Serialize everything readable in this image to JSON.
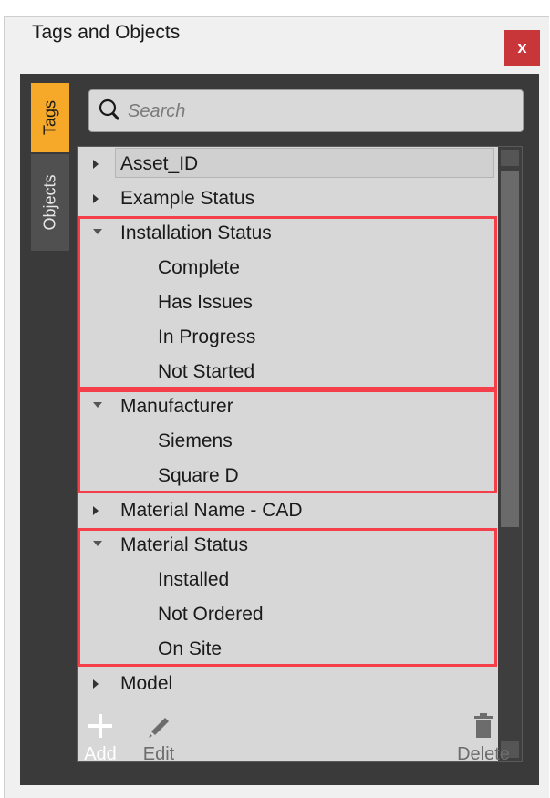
{
  "window": {
    "title": "Tags and Objects",
    "close_label": "x"
  },
  "tabs": [
    {
      "label": "Tags",
      "active": true
    },
    {
      "label": "Objects",
      "active": false
    }
  ],
  "search": {
    "placeholder": "Search",
    "value": ""
  },
  "tree": {
    "items": [
      {
        "label": "Asset_ID",
        "level": 0,
        "expanded": false,
        "selected": true
      },
      {
        "label": "Example Status",
        "level": 0,
        "expanded": false
      },
      {
        "label": "Installation Status",
        "level": 0,
        "expanded": true
      },
      {
        "label": "Complete",
        "level": 1
      },
      {
        "label": "Has Issues",
        "level": 1
      },
      {
        "label": "In Progress",
        "level": 1
      },
      {
        "label": "Not Started",
        "level": 1
      },
      {
        "label": "Manufacturer",
        "level": 0,
        "expanded": true
      },
      {
        "label": "Siemens",
        "level": 1
      },
      {
        "label": "Square D",
        "level": 1
      },
      {
        "label": "Material Name - CAD",
        "level": 0,
        "expanded": false
      },
      {
        "label": "Material Status",
        "level": 0,
        "expanded": true
      },
      {
        "label": "Installed",
        "level": 1
      },
      {
        "label": "Not Ordered",
        "level": 1
      },
      {
        "label": "On Site",
        "level": 1
      },
      {
        "label": "Model",
        "level": 0,
        "expanded": false
      }
    ]
  },
  "toolbar": {
    "add_label": "Add",
    "edit_label": "Edit",
    "delete_label": "Delete"
  },
  "colors": {
    "active_tab": "#f6a928",
    "highlight": "#f43f4a",
    "panel": "#3a3a3a",
    "close": "#c8363a"
  }
}
